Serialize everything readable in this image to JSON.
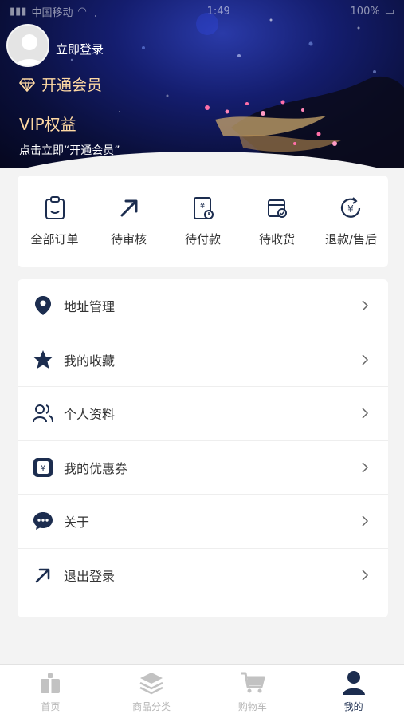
{
  "status_bar": {
    "carrier": "中国移动",
    "time": "1:49",
    "battery": "100%"
  },
  "profile": {
    "login_label": "立即登录"
  },
  "vip": {
    "member_label": "开通会员",
    "title": "VIP权益",
    "description": "点击立即“开通会员”"
  },
  "orders": {
    "items": [
      {
        "label": "全部订单",
        "icon": "clipboard-icon"
      },
      {
        "label": "待审核",
        "icon": "arrow-up-right-icon"
      },
      {
        "label": "待付款",
        "icon": "payment-icon"
      },
      {
        "label": "待收货",
        "icon": "box-check-icon"
      },
      {
        "label": "退款/售后",
        "icon": "refund-icon"
      }
    ]
  },
  "menu": {
    "items": [
      {
        "label": "地址管理",
        "icon": "location-pin-icon"
      },
      {
        "label": "我的收藏",
        "icon": "star-icon"
      },
      {
        "label": "个人资料",
        "icon": "users-icon"
      },
      {
        "label": "我的优惠券",
        "icon": "coupon-icon"
      },
      {
        "label": "关于",
        "icon": "chat-bubble-icon"
      },
      {
        "label": "退出登录",
        "icon": "logout-arrow-icon"
      }
    ]
  },
  "tabbar": {
    "items": [
      {
        "label": "首页",
        "icon": "home-gift-icon",
        "active": false
      },
      {
        "label": "商品分类",
        "icon": "layers-icon",
        "active": false
      },
      {
        "label": "购物车",
        "icon": "cart-icon",
        "active": false
      },
      {
        "label": "我的",
        "icon": "user-icon",
        "active": true
      }
    ]
  },
  "colors": {
    "primary": "#1c2d4f",
    "gold": "#ffd9a3",
    "inactive": "#b5b5b5"
  }
}
